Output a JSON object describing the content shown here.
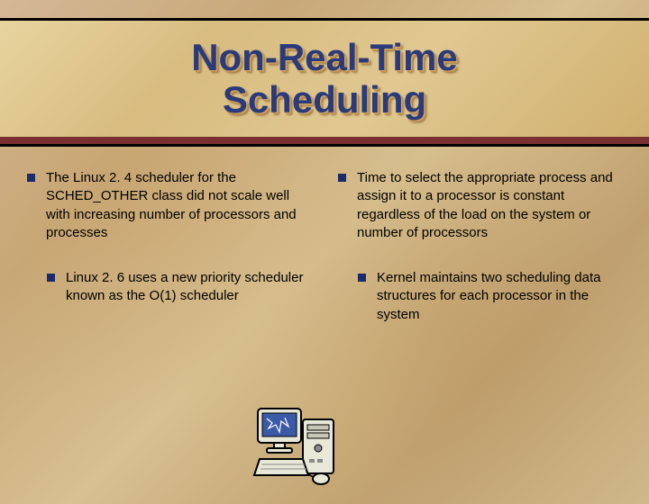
{
  "title": "Non-Real-Time\nScheduling",
  "left_column": {
    "item1": "The Linux 2. 4 scheduler for the SCHED_OTHER class did not scale well with increasing number of processors and processes",
    "item2": "Linux 2. 6 uses a new priority scheduler known as the O(1) scheduler"
  },
  "right_column": {
    "item1": "Time to select the appropriate process and assign it to a processor is constant regardless of the load on the system or number of processors",
    "item2": "Kernel maintains two scheduling data structures for each processor in the system"
  }
}
